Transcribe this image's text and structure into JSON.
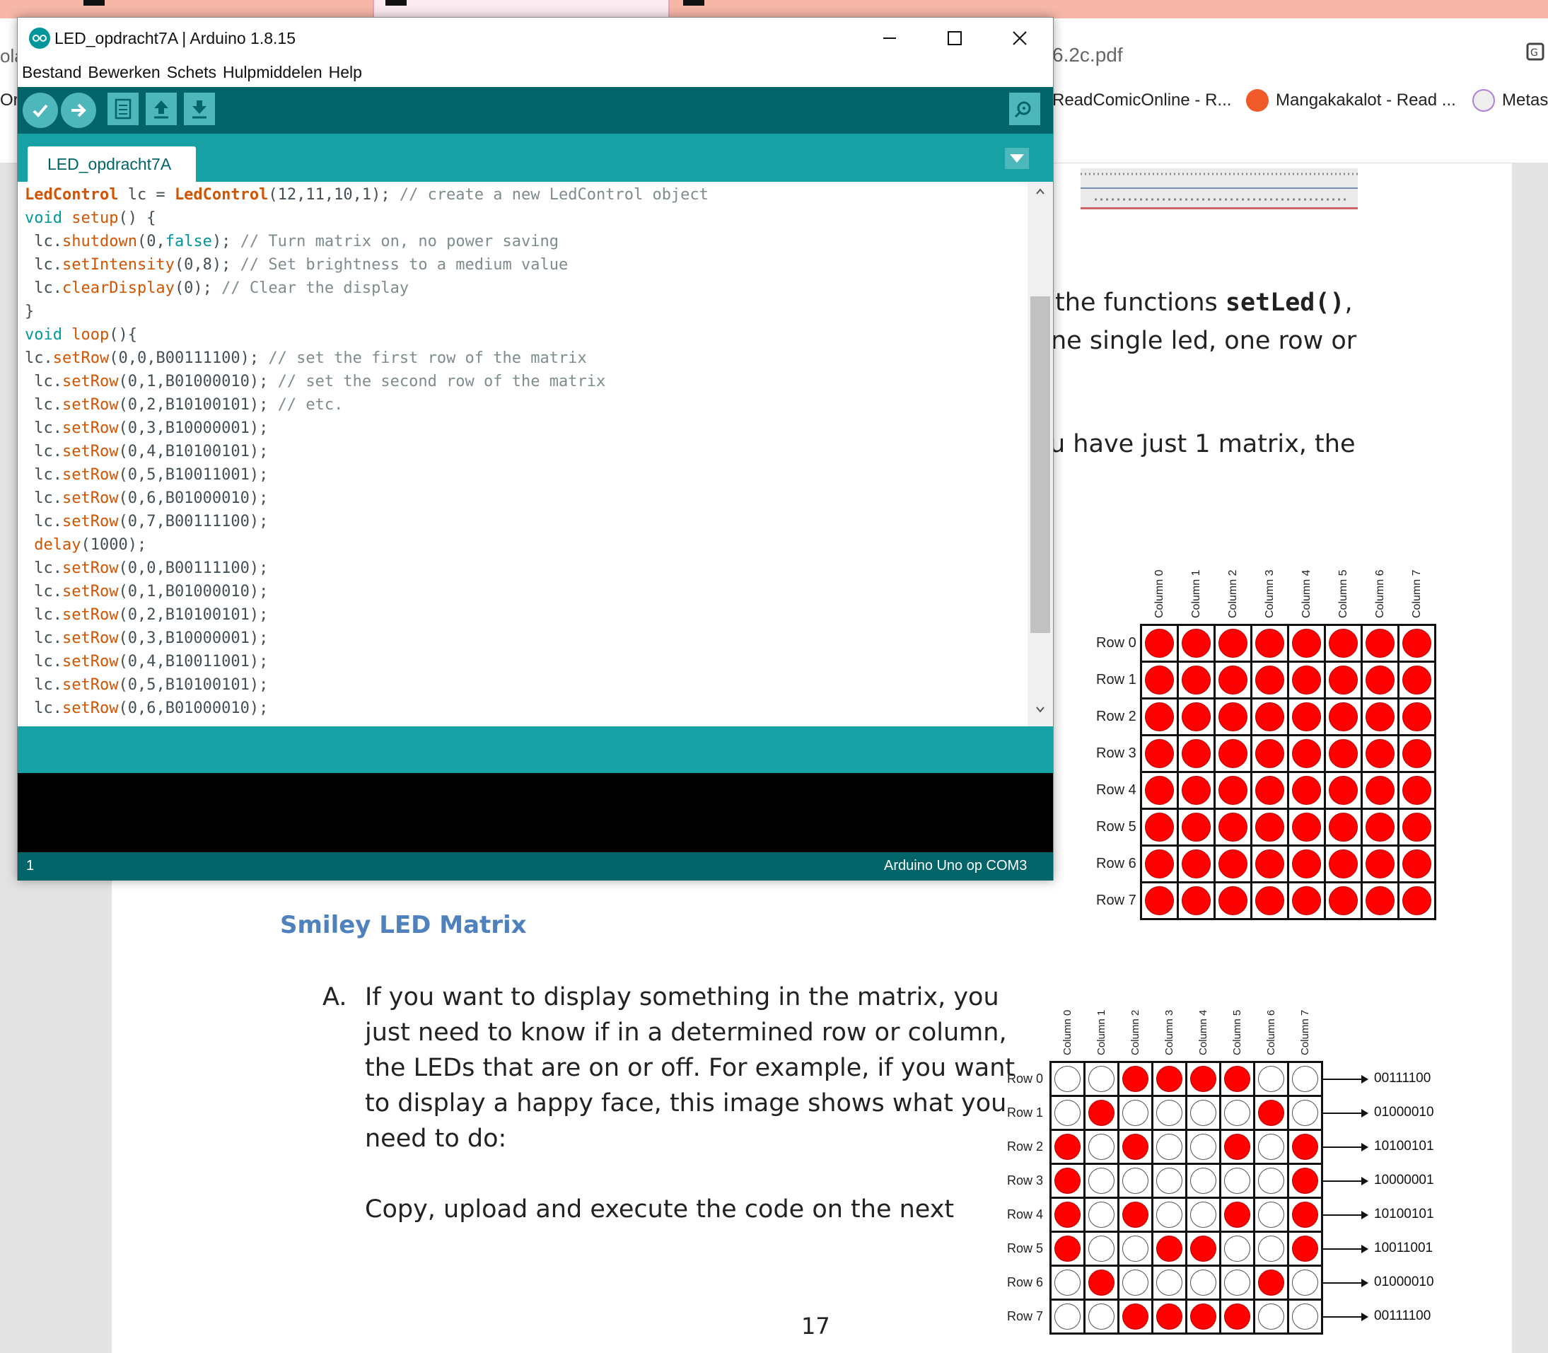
{
  "browser": {
    "address_fragment": "6.2c.pdf",
    "left_fragment_top": "ola",
    "left_fragment_bm": "Or",
    "bookmarks": [
      {
        "label": "ReadComicOnline - R...",
        "icon": "readcomiconline-icon"
      },
      {
        "label": "Mangakakalot - Read ...",
        "icon": "mangakakalot-icon",
        "color": "#f05a28"
      },
      {
        "label": "Metas",
        "icon": "metas-icon"
      }
    ]
  },
  "arduino": {
    "title": "LED_opdracht7A | Arduino 1.8.15",
    "menu": [
      "Bestand",
      "Bewerken",
      "Schets",
      "Hulpmiddelen",
      "Help"
    ],
    "tab": "LED_opdracht7A",
    "status_line": "1",
    "board": "Arduino Uno op COM3",
    "colors": {
      "toolbar": "#006468",
      "teal": "#17a1a5",
      "console": "#000000"
    }
  },
  "code": [
    [
      [
        "cls",
        "LedControl"
      ],
      [
        "p",
        " lc = "
      ],
      [
        "cls",
        "LedControl"
      ],
      [
        "p",
        "(12,11,10,1); "
      ],
      [
        "cm",
        "// create a new LedControl object"
      ]
    ],
    [
      [
        "ty",
        "void"
      ],
      [
        "p",
        " "
      ],
      [
        "fn",
        "setup"
      ],
      [
        "p",
        "() {"
      ]
    ],
    [
      [
        "p",
        " lc."
      ],
      [
        "fn",
        "shutdown"
      ],
      [
        "p",
        "(0,"
      ],
      [
        "ty",
        "false"
      ],
      [
        "p",
        "); "
      ],
      [
        "cm",
        "// Turn matrix on, no power saving"
      ]
    ],
    [
      [
        "p",
        " lc."
      ],
      [
        "fn",
        "setIntensity"
      ],
      [
        "p",
        "(0,8); "
      ],
      [
        "cm",
        "// Set brightness to a medium value"
      ]
    ],
    [
      [
        "p",
        " lc."
      ],
      [
        "fn",
        "clearDisplay"
      ],
      [
        "p",
        "(0); "
      ],
      [
        "cm",
        "// Clear the display"
      ]
    ],
    [
      [
        "p",
        "}"
      ]
    ],
    [
      [
        "ty",
        "void"
      ],
      [
        "p",
        " "
      ],
      [
        "fn",
        "loop"
      ],
      [
        "p",
        "(){"
      ]
    ],
    [
      [
        "p",
        "lc."
      ],
      [
        "fn",
        "setRow"
      ],
      [
        "p",
        "(0,0,B00111100); "
      ],
      [
        "cm",
        "// set the first row of the matrix"
      ]
    ],
    [
      [
        "p",
        " lc."
      ],
      [
        "fn",
        "setRow"
      ],
      [
        "p",
        "(0,1,B01000010); "
      ],
      [
        "cm",
        "// set the second row of the matrix"
      ]
    ],
    [
      [
        "p",
        " lc."
      ],
      [
        "fn",
        "setRow"
      ],
      [
        "p",
        "(0,2,B10100101); "
      ],
      [
        "cm",
        "// etc."
      ]
    ],
    [
      [
        "p",
        " lc."
      ],
      [
        "fn",
        "setRow"
      ],
      [
        "p",
        "(0,3,B10000001);"
      ]
    ],
    [
      [
        "p",
        " lc."
      ],
      [
        "fn",
        "setRow"
      ],
      [
        "p",
        "(0,4,B10100101);"
      ]
    ],
    [
      [
        "p",
        " lc."
      ],
      [
        "fn",
        "setRow"
      ],
      [
        "p",
        "(0,5,B10011001);"
      ]
    ],
    [
      [
        "p",
        " lc."
      ],
      [
        "fn",
        "setRow"
      ],
      [
        "p",
        "(0,6,B01000010);"
      ]
    ],
    [
      [
        "p",
        " lc."
      ],
      [
        "fn",
        "setRow"
      ],
      [
        "p",
        "(0,7,B00111100);"
      ]
    ],
    [
      [
        "p",
        " "
      ],
      [
        "fn",
        "delay"
      ],
      [
        "p",
        "(1000);"
      ]
    ],
    [
      [
        "p",
        " lc."
      ],
      [
        "fn",
        "setRow"
      ],
      [
        "p",
        "(0,0,B00111100);"
      ]
    ],
    [
      [
        "p",
        " lc."
      ],
      [
        "fn",
        "setRow"
      ],
      [
        "p",
        "(0,1,B01000010);"
      ]
    ],
    [
      [
        "p",
        " lc."
      ],
      [
        "fn",
        "setRow"
      ],
      [
        "p",
        "(0,2,B10100101);"
      ]
    ],
    [
      [
        "p",
        " lc."
      ],
      [
        "fn",
        "setRow"
      ],
      [
        "p",
        "(0,3,B10000001);"
      ]
    ],
    [
      [
        "p",
        " lc."
      ],
      [
        "fn",
        "setRow"
      ],
      [
        "p",
        "(0,4,B10011001);"
      ]
    ],
    [
      [
        "p",
        " lc."
      ],
      [
        "fn",
        "setRow"
      ],
      [
        "p",
        "(0,5,B10100101);"
      ]
    ],
    [
      [
        "p",
        " lc."
      ],
      [
        "fn",
        "setRow"
      ],
      [
        "p",
        "(0,6,B01000010);"
      ]
    ]
  ],
  "pdf": {
    "line1_text": "the functions ",
    "line1_code": "setLed()",
    "line1_tail": ",",
    "line2": "ne single led, one row or",
    "line3": "u have just 1 matrix, the",
    "heading": "Smiley LED Matrix",
    "item_letter": "A.",
    "paragraph": [
      "If you want to display something in the matrix, you",
      "just need to know if in a determined row or column,",
      "the LEDs that are on or off. For example, if you want",
      "to display a happy face, this image shows what you",
      "need to do:"
    ],
    "paragraph2": "Copy, upload and execute the code on the next",
    "page_number": "17",
    "heading_color": "#4f81bd"
  },
  "matrix_labels": {
    "columns": [
      "Column 0",
      "Column 1",
      "Column 2",
      "Column 3",
      "Column 4",
      "Column 5",
      "Column 6",
      "Column 7"
    ],
    "rows": [
      "Row 0",
      "Row 1",
      "Row 2",
      "Row 3",
      "Row 4",
      "Row 5",
      "Row 6",
      "Row 7"
    ]
  },
  "smiley_rows": [
    "00111100",
    "01000010",
    "10100101",
    "10000001",
    "10100101",
    "10011001",
    "01000010",
    "00111100"
  ]
}
